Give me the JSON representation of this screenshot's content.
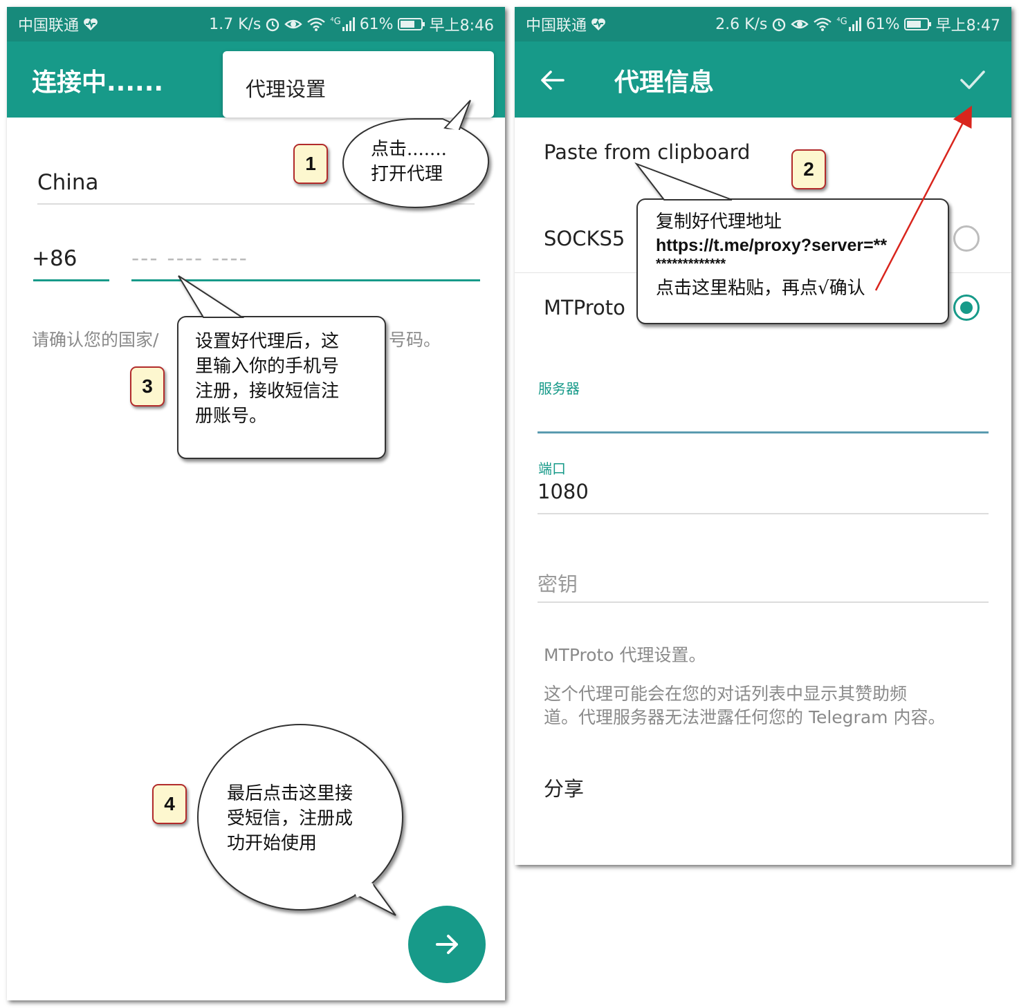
{
  "left_screen": {
    "status": {
      "carrier": "中国联通",
      "speed": "1.7 K/s",
      "signal_tag": "⁴G",
      "battery": "61%",
      "time": "早上8:46"
    },
    "appbar": {
      "title": "连接中......"
    },
    "popup_menu": {
      "item": "代理设置"
    },
    "country": "China",
    "country_code": "+86",
    "phone_placeholder": "--- ---- ----",
    "hint": "请确认您的国家/",
    "hint_suffix": "号码。"
  },
  "right_screen": {
    "status": {
      "carrier": "中国联通",
      "speed": "2.6 K/s",
      "signal_tag": "⁴G",
      "battery": "61%",
      "time": "早上8:47"
    },
    "appbar": {
      "title": "代理信息"
    },
    "paste_label": "Paste from clipboard",
    "options": [
      {
        "label": "SOCKS5",
        "selected": false
      },
      {
        "label": "MTProto",
        "selected": true
      }
    ],
    "server_label": "服务器",
    "port_label": "端口",
    "port_value": "1080",
    "secret_placeholder": "密钥",
    "info_title": "MTProto 代理设置。",
    "info_line1": "这个代理可能会在您的对话列表中显示其赞助频",
    "info_line2": "道。代理服务器无法泄露任何您的 Telegram 内容。",
    "share_label": "分享"
  },
  "annotations": {
    "badges": [
      "1",
      "2",
      "3",
      "4"
    ],
    "callout1": [
      "点击.......",
      "打开代理"
    ],
    "callout2": [
      "复制好代理地址",
      "https://t.me/proxy?server=**",
      "*************",
      "点击这里粘贴，再点√确认"
    ],
    "callout3": [
      "设置好代理后，这",
      "里输入你的手机号",
      "注册，接收短信注",
      "册账号。"
    ],
    "callout4": [
      "最后点击这里接",
      "受短信，注册成",
      "功开始使用"
    ]
  },
  "colors": {
    "teal": "#179a89",
    "status_teal": "#178a7b",
    "badge_fill": "#fdf7cf",
    "badge_border": "#b22b2b",
    "arrow_red": "#d9251d"
  },
  "icons": [
    "heart-icon",
    "alarm-icon",
    "eye-icon",
    "wifi-icon",
    "signal-icon",
    "battery-icon",
    "back-arrow-icon",
    "check-icon",
    "forward-arrow-icon"
  ]
}
